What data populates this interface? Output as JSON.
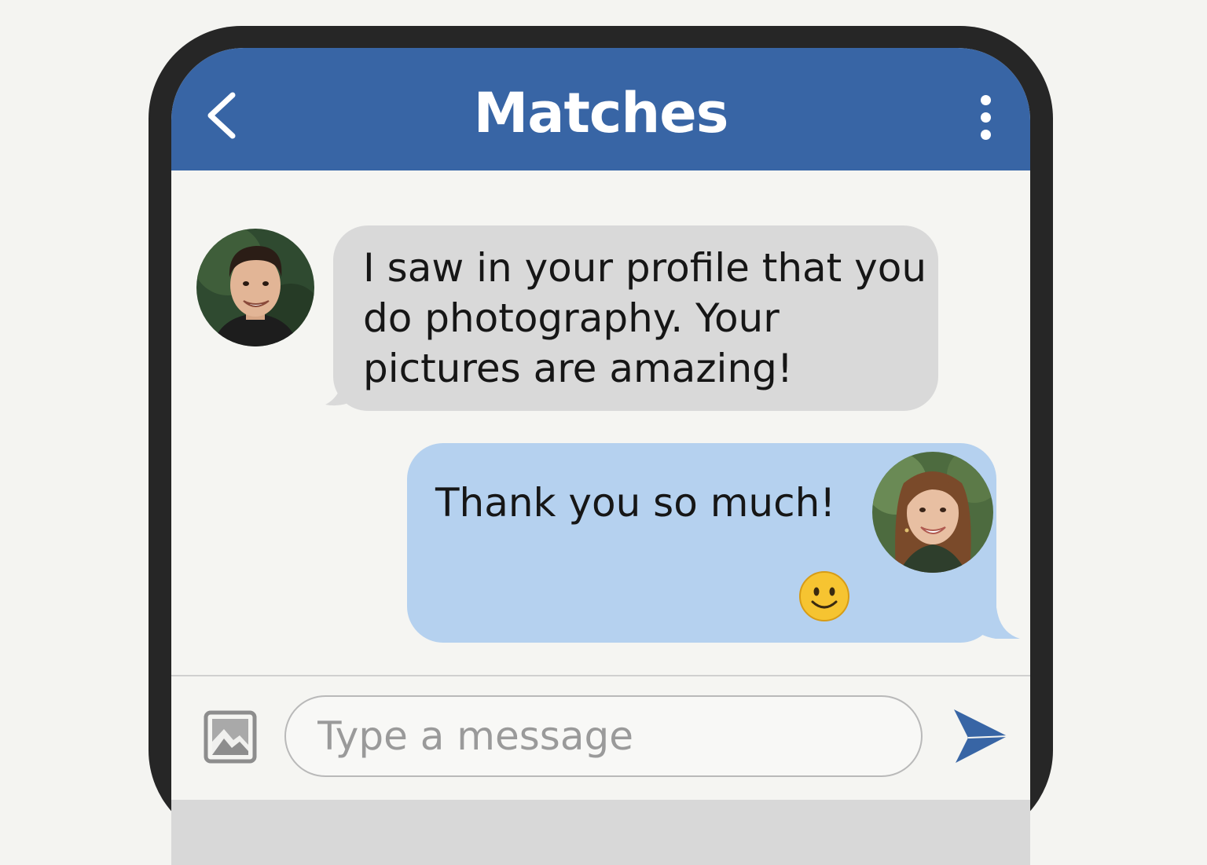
{
  "header": {
    "title": "Matches",
    "back_icon": "chevron-left-icon",
    "more_icon": "more-vertical-icon"
  },
  "messages": [
    {
      "sender": "match",
      "text": "I saw in your profile that you do photography. Your pictures are amazing!"
    },
    {
      "sender": "me",
      "text": "Thank you so much!",
      "emoji": "slightly-smiling-face"
    }
  ],
  "composer": {
    "placeholder": "Type a message",
    "image_icon": "image-icon",
    "send_icon": "send-icon"
  },
  "colors": {
    "header": "#3865a5",
    "incoming_bubble": "#d9d9d9",
    "outgoing_bubble": "#b5d1ef",
    "send_icon": "#3865a5",
    "frame": "#262626"
  }
}
